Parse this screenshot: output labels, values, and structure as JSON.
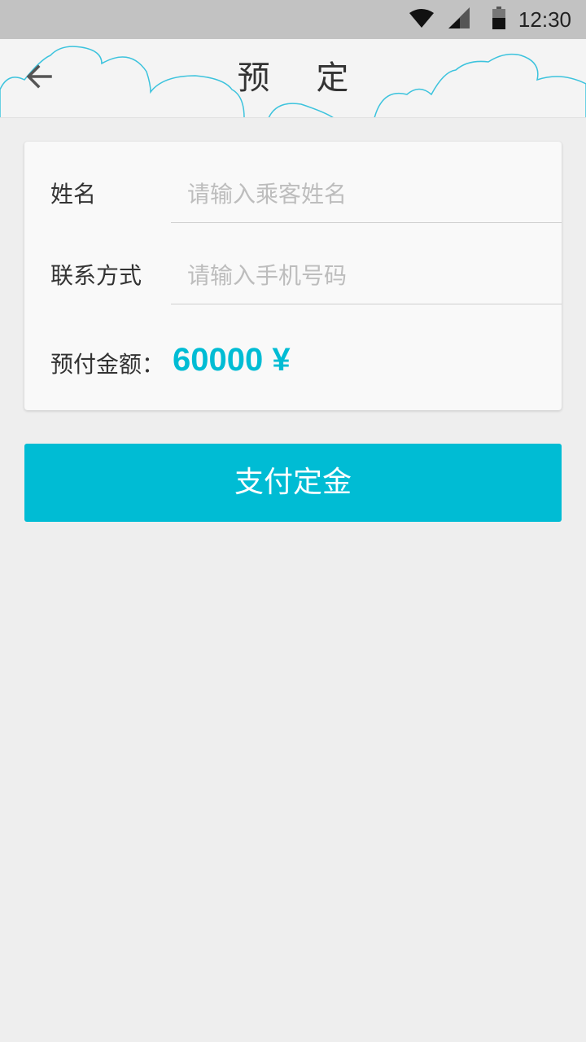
{
  "status_bar": {
    "time": "12:30",
    "icons": [
      "wifi-icon",
      "signal-icon",
      "battery-icon"
    ]
  },
  "header": {
    "title": "预 定",
    "back_icon": "arrow-left-icon"
  },
  "form": {
    "name": {
      "label": "姓名",
      "placeholder": "请输入乘客姓名",
      "value": ""
    },
    "phone": {
      "label": "联系方式",
      "placeholder": "请输入手机号码",
      "value": ""
    },
    "amount": {
      "label": "预付金额：",
      "value": "60000 ¥"
    }
  },
  "actions": {
    "pay_label": "支付定金"
  },
  "colors": {
    "accent": "#00bcd4",
    "background": "#eeeeee",
    "card": "#f9f9f9",
    "status_bar": "#c2c2c2"
  }
}
